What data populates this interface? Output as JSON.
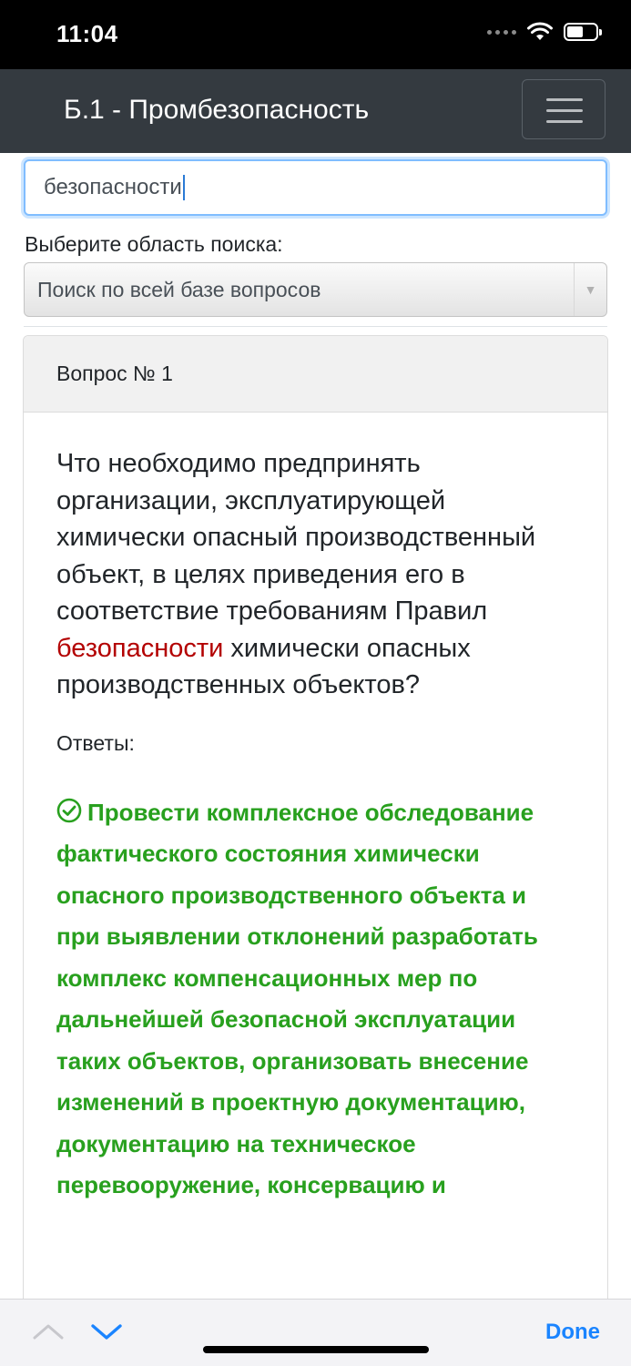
{
  "status_bar": {
    "time": "11:04"
  },
  "navbar": {
    "title": "Б.1 - Промбезопасность",
    "menu_icon": "hamburger-menu-icon"
  },
  "search": {
    "value": "безопасности"
  },
  "scope": {
    "label": "Выберите область поиска:",
    "selected": "Поиск по всей базе вопросов"
  },
  "card": {
    "header": "Вопрос № 1",
    "question_before": "Что необходимо предпринять организации, эксплуатирующей химически опасный производственный объект, в целях приведения его в соответствие требованиям Правил ",
    "question_highlight": "безопасности",
    "question_after": " химически опасных производственных объектов?",
    "answers_label": "Ответы:",
    "answer_text": "Провести комплексное обследование фактического состояния химически опасного производственного объекта и при выявлении отклонений разработать комплекс компенсационных мер по дальнейшей безопасной эксплуатации таких объектов, организовать внесение изменений в проектную документацию, документацию на техническое перевооружение, консервацию и",
    "answer_icon": "check-circle-icon"
  },
  "keyboard_bar": {
    "done": "Done"
  },
  "colors": {
    "navbar": "#343a40",
    "highlight": "#b30000",
    "correct_answer": "#28a01e",
    "done": "#1a84ff"
  }
}
